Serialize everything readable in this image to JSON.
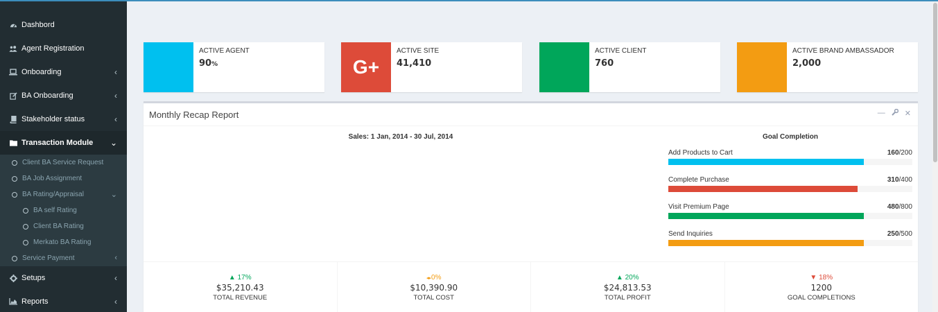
{
  "sidebar": {
    "items": [
      {
        "label": "Dashbord",
        "icon": "dashboard-icon"
      },
      {
        "label": "Agent Registration",
        "icon": "users-icon"
      },
      {
        "label": "Onboarding",
        "icon": "laptop-icon"
      },
      {
        "label": "BA Onboarding",
        "icon": "edit-icon"
      },
      {
        "label": "Stakeholder status",
        "icon": "book-icon"
      },
      {
        "label": "Transaction Module",
        "icon": "folder-icon"
      }
    ],
    "transaction_sub": [
      {
        "label": "Client BA Service Request"
      },
      {
        "label": "BA Job Assignment"
      },
      {
        "label": "BA Rating/Appraisal"
      }
    ],
    "rating_sub": [
      {
        "label": "BA self Rating"
      },
      {
        "label": "Client BA Rating"
      },
      {
        "label": "Merkato BA Rating"
      }
    ],
    "service_payment": {
      "label": "Service Payment"
    },
    "bottom_items": [
      {
        "label": "Setups",
        "icon": "cog-icon"
      },
      {
        "label": "Reports",
        "icon": "area-chart-icon"
      }
    ]
  },
  "info_boxes": [
    {
      "label": "Active Agent",
      "value_main": "90",
      "value_unit": "%",
      "color": "#00c0ef"
    },
    {
      "label": "Active Site",
      "value_main": "41,410",
      "value_unit": "",
      "color": "#dd4b39",
      "icon_text": "G+"
    },
    {
      "label": "Active Client",
      "value_main": "760",
      "value_unit": "",
      "color": "#00a65a"
    },
    {
      "label": "Active Brand Ambassador",
      "value_main": "2,000",
      "value_unit": "",
      "color": "#f39c12"
    }
  ],
  "report": {
    "title": "Monthly Recap Report",
    "chart_title": "Sales: 1 Jan, 2014 - 30 Jul, 2014",
    "goal_title": "Goal Completion",
    "goals": [
      {
        "label": "Add Products to Cart",
        "value": "160",
        "total": "/200",
        "fraction": 0.8,
        "color": "#00c0ef"
      },
      {
        "label": "Complete Purchase",
        "value": "310",
        "total": "/400",
        "fraction": 0.775,
        "color": "#dd4b39"
      },
      {
        "label": "Visit Premium Page",
        "value": "480",
        "total": "/800",
        "fraction": 0.8,
        "color": "#00a65a"
      },
      {
        "label": "Send Inquiries",
        "value": "250",
        "total": "/500",
        "fraction": 0.8,
        "color": "#f39c12"
      }
    ],
    "footer": [
      {
        "pct": "17%",
        "arrow": "▲",
        "color": "#00a65a",
        "amount": "$35,210.43",
        "label": "Total Revenue"
      },
      {
        "pct": "0%",
        "arrow": "◂▸",
        "color": "#f39c12",
        "amount": "$10,390.90",
        "label": "Total Cost"
      },
      {
        "pct": "20%",
        "arrow": "▲",
        "color": "#00a65a",
        "amount": "$24,813.53",
        "label": "Total Profit"
      },
      {
        "pct": "18%",
        "arrow": "▼",
        "color": "#dd4b39",
        "amount": "1200",
        "label": "Goal Completions"
      }
    ]
  }
}
